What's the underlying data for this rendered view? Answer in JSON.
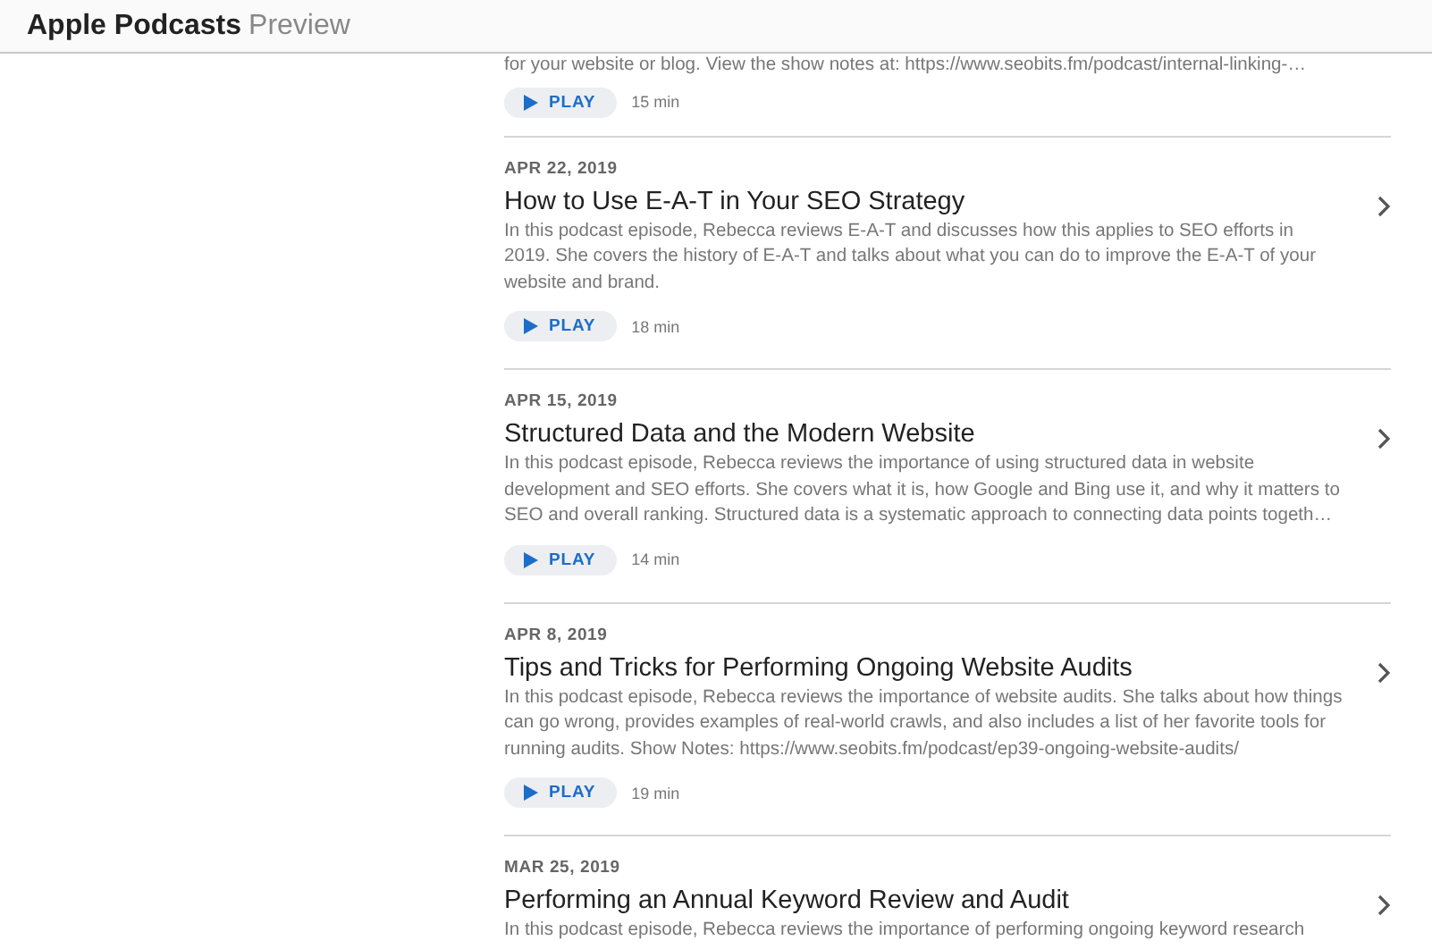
{
  "header": {
    "brand": "Apple Podcasts",
    "suffix": "Preview"
  },
  "episodes": [
    {
      "description": "for your website or blog. View the show notes at: https://www.seobits.fm/podcast/internal-linking-…",
      "play": "PLAY",
      "duration": "15 min"
    },
    {
      "date": "APR 22, 2019",
      "title": "How to Use E-A-T in Your SEO Strategy",
      "description": "In this podcast episode, Rebecca reviews E-A-T and discusses how this applies to SEO efforts in 2019. She covers the history of E-A-T and talks about what you can do to improve the E-A-T of your website and brand.",
      "play": "PLAY",
      "duration": "18 min"
    },
    {
      "date": "APR 15, 2019",
      "title": "Structured Data and the Modern Website",
      "description": "In this podcast episode, Rebecca reviews the importance of using structured data in website development and SEO efforts. She covers what it is, how Google and Bing use it, and why it matters to SEO and overall ranking. Structured data is a systematic approach to connecting data points togeth…",
      "play": "PLAY",
      "duration": "14 min"
    },
    {
      "date": "APR 8, 2019",
      "title": "Tips and Tricks for Performing Ongoing Website Audits",
      "description": "In this podcast episode, Rebecca reviews the importance of website audits. She talks about how things can go wrong, provides examples of real-world crawls, and also includes a list of her favorite tools for running audits. Show Notes: https://www.seobits.fm/podcast/ep39-ongoing-website-audits/",
      "play": "PLAY",
      "duration": "19 min"
    },
    {
      "date": "MAR 25, 2019",
      "title": "Performing an Annual Keyword Review and Audit",
      "description": "In this podcast episode, Rebecca reviews the importance of performing ongoing keyword research"
    }
  ]
}
